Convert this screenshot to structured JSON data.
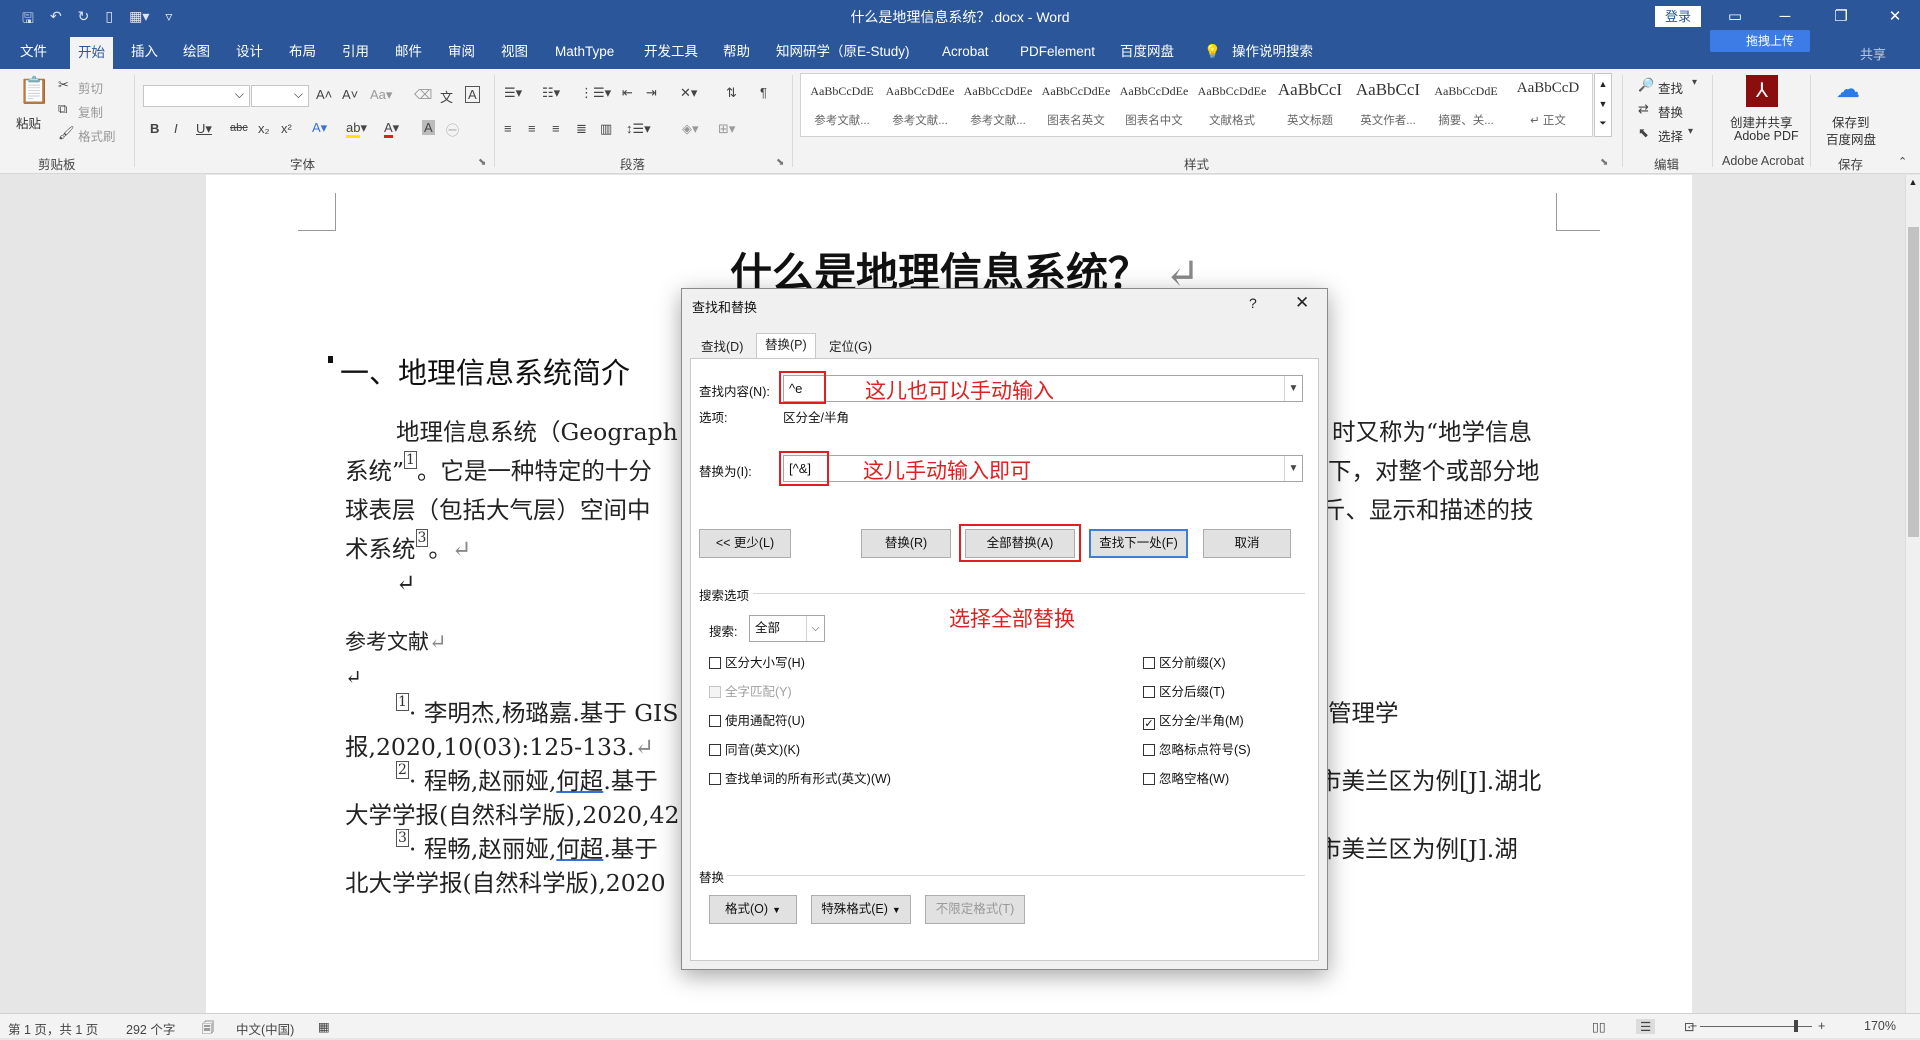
{
  "window": {
    "title": "什么是地理信息系统？.docx - Word",
    "login_label": "登录",
    "upload_label": "拖拽上传",
    "share_label": "共享",
    "min_icon": "minimize-icon",
    "restore_icon": "restore-icon",
    "close_icon": "close-icon"
  },
  "menu": {
    "items": [
      "文件",
      "开始",
      "插入",
      "绘图",
      "设计",
      "布局",
      "引用",
      "邮件",
      "审阅",
      "视图",
      "MathType",
      "开发工具",
      "帮助",
      "知网研学（原E-Study)",
      "Acrobat",
      "PDFelement",
      "百度网盘",
      "操作说明搜索"
    ],
    "active_index": 1
  },
  "ribbon": {
    "clipboard": {
      "paste": "粘贴",
      "cut": "剪切",
      "copy": "复制",
      "format_painter": "格式刷",
      "label": "剪贴板"
    },
    "font": {
      "label": "字体",
      "aa_label": "Aa"
    },
    "paragraph": {
      "label": "段落"
    },
    "styles": {
      "label": "样式",
      "items": [
        {
          "sample": "AaBbCcDdE",
          "name": "参考文献..."
        },
        {
          "sample": "AaBbCcDdEe",
          "name": "参考文献..."
        },
        {
          "sample": "AaBbCcDdEe",
          "name": "参考文献..."
        },
        {
          "sample": "AaBbCcDdEe",
          "name": "图表名英文"
        },
        {
          "sample": "AaBbCcDdEe",
          "name": "图表名中文"
        },
        {
          "sample": "AaBbCcDdEe",
          "name": "文献格式"
        },
        {
          "sample": "AaBbCcI",
          "name": "英文标题"
        },
        {
          "sample": "AaBbCcI",
          "name": "英文作者..."
        },
        {
          "sample": "AaBbCcDdE",
          "name": "摘要、关..."
        },
        {
          "sample": "AaBbCcD",
          "name": "↵ 正文"
        }
      ]
    },
    "editing": {
      "find": "查找",
      "replace": "替换",
      "select": "选择",
      "label": "编辑"
    },
    "acrobat": {
      "line1": "创建并共享",
      "line2": "Adobe PDF",
      "label": "Adobe Acrobat"
    },
    "baidu": {
      "line1": "保存到",
      "line2": "百度网盘",
      "label": "保存"
    }
  },
  "document": {
    "title": "什么是地理信息系统？",
    "heading": "一、地理信息系统简介",
    "para1_line1_left": "地理信息系统（Geograph",
    "para1_line1_right": "时又称为“地学信息",
    "para1_line2_left": "系统”",
    "para1_line2_mid": "。它是一种特定的十分",
    "para1_line2_right": "下，对整个或部分地",
    "para1_line3_left": "球表层（包括大气层）空间中",
    "para1_line3_right": "斤、显示和描述的技",
    "para1_line4": "术系统",
    "para1_line4_end": "。",
    "refs_heading": "参考文献",
    "ref1_line1_left": "· 李明杰,杨璐嘉.基于 GIS",
    "ref1_line1_right": "管理学",
    "ref1_line2": "报,2020,10(03):125-133.",
    "ref2_line1_left": "· 程畅,赵丽娅,",
    "ref2_line1_name": "何超",
    "ref2_line1_tail": ".基于",
    "ref2_line1_right": "市美兰区为例[J].湖北",
    "ref2_line2": "大学学报(自然科学版),2020,42",
    "ref3_line1_left": "· 程畅,赵丽娅,",
    "ref3_line1_name": "何超",
    "ref3_line1_tail": ".基于",
    "ref3_line1_right": "市美兰区为例[J].湖",
    "ref3_line2": "北大学学报(自然科学版),2020",
    "ref_marks": [
      "1",
      "2",
      "3"
    ],
    "pilcrow": "↵"
  },
  "dialog": {
    "title": "查找和替换",
    "help": "?",
    "tabs": [
      "查找(D)",
      "替换(P)",
      "定位(G)"
    ],
    "active_tab": 1,
    "find_label": "查找内容(N):",
    "find_value": "^e",
    "options_label": "选项:",
    "options_value": "区分全/半角",
    "replace_label": "替换为(I):",
    "replace_value": "[^&]",
    "annotation_find": "这儿也可以手动输入",
    "annotation_replace": "这儿手动输入即可",
    "annotation_replace_all": "选择全部替换",
    "btn_less": "<< 更少(L)",
    "btn_replace": "替换(R)",
    "btn_replace_all": "全部替换(A)",
    "btn_find_next": "查找下一处(F)",
    "btn_cancel": "取消",
    "search_options_label": "搜索选项",
    "search_label": "搜索:",
    "search_value": "全部",
    "checks_left": [
      {
        "label": "区分大小写(H)",
        "checked": false,
        "disabled": false
      },
      {
        "label": "全字匹配(Y)",
        "checked": false,
        "disabled": true
      },
      {
        "label": "使用通配符(U)",
        "checked": false,
        "disabled": false
      },
      {
        "label": "同音(英文)(K)",
        "checked": false,
        "disabled": false
      },
      {
        "label": "查找单词的所有形式(英文)(W)",
        "checked": false,
        "disabled": false
      }
    ],
    "checks_right": [
      {
        "label": "区分前缀(X)",
        "checked": false,
        "disabled": false
      },
      {
        "label": "区分后缀(T)",
        "checked": false,
        "disabled": false
      },
      {
        "label": "区分全/半角(M)",
        "checked": true,
        "disabled": false
      },
      {
        "label": "忽略标点符号(S)",
        "checked": false,
        "disabled": false
      },
      {
        "label": "忽略空格(W)",
        "checked": false,
        "disabled": false
      }
    ],
    "replace_section_label": "替换",
    "btn_format": "格式(O)",
    "btn_special": "特殊格式(E)",
    "btn_no_format": "不限定格式(T)"
  },
  "statusbar": {
    "page": "第 1 页，共 1 页",
    "words": "292 个字",
    "lang": "中文(中国)",
    "zoom": "170%",
    "zoom_minus": "−",
    "zoom_plus": "+"
  },
  "colors": {
    "word_blue": "#2b579a",
    "annotation_red": "#e02020",
    "focus_blue": "#3c7fd8"
  }
}
